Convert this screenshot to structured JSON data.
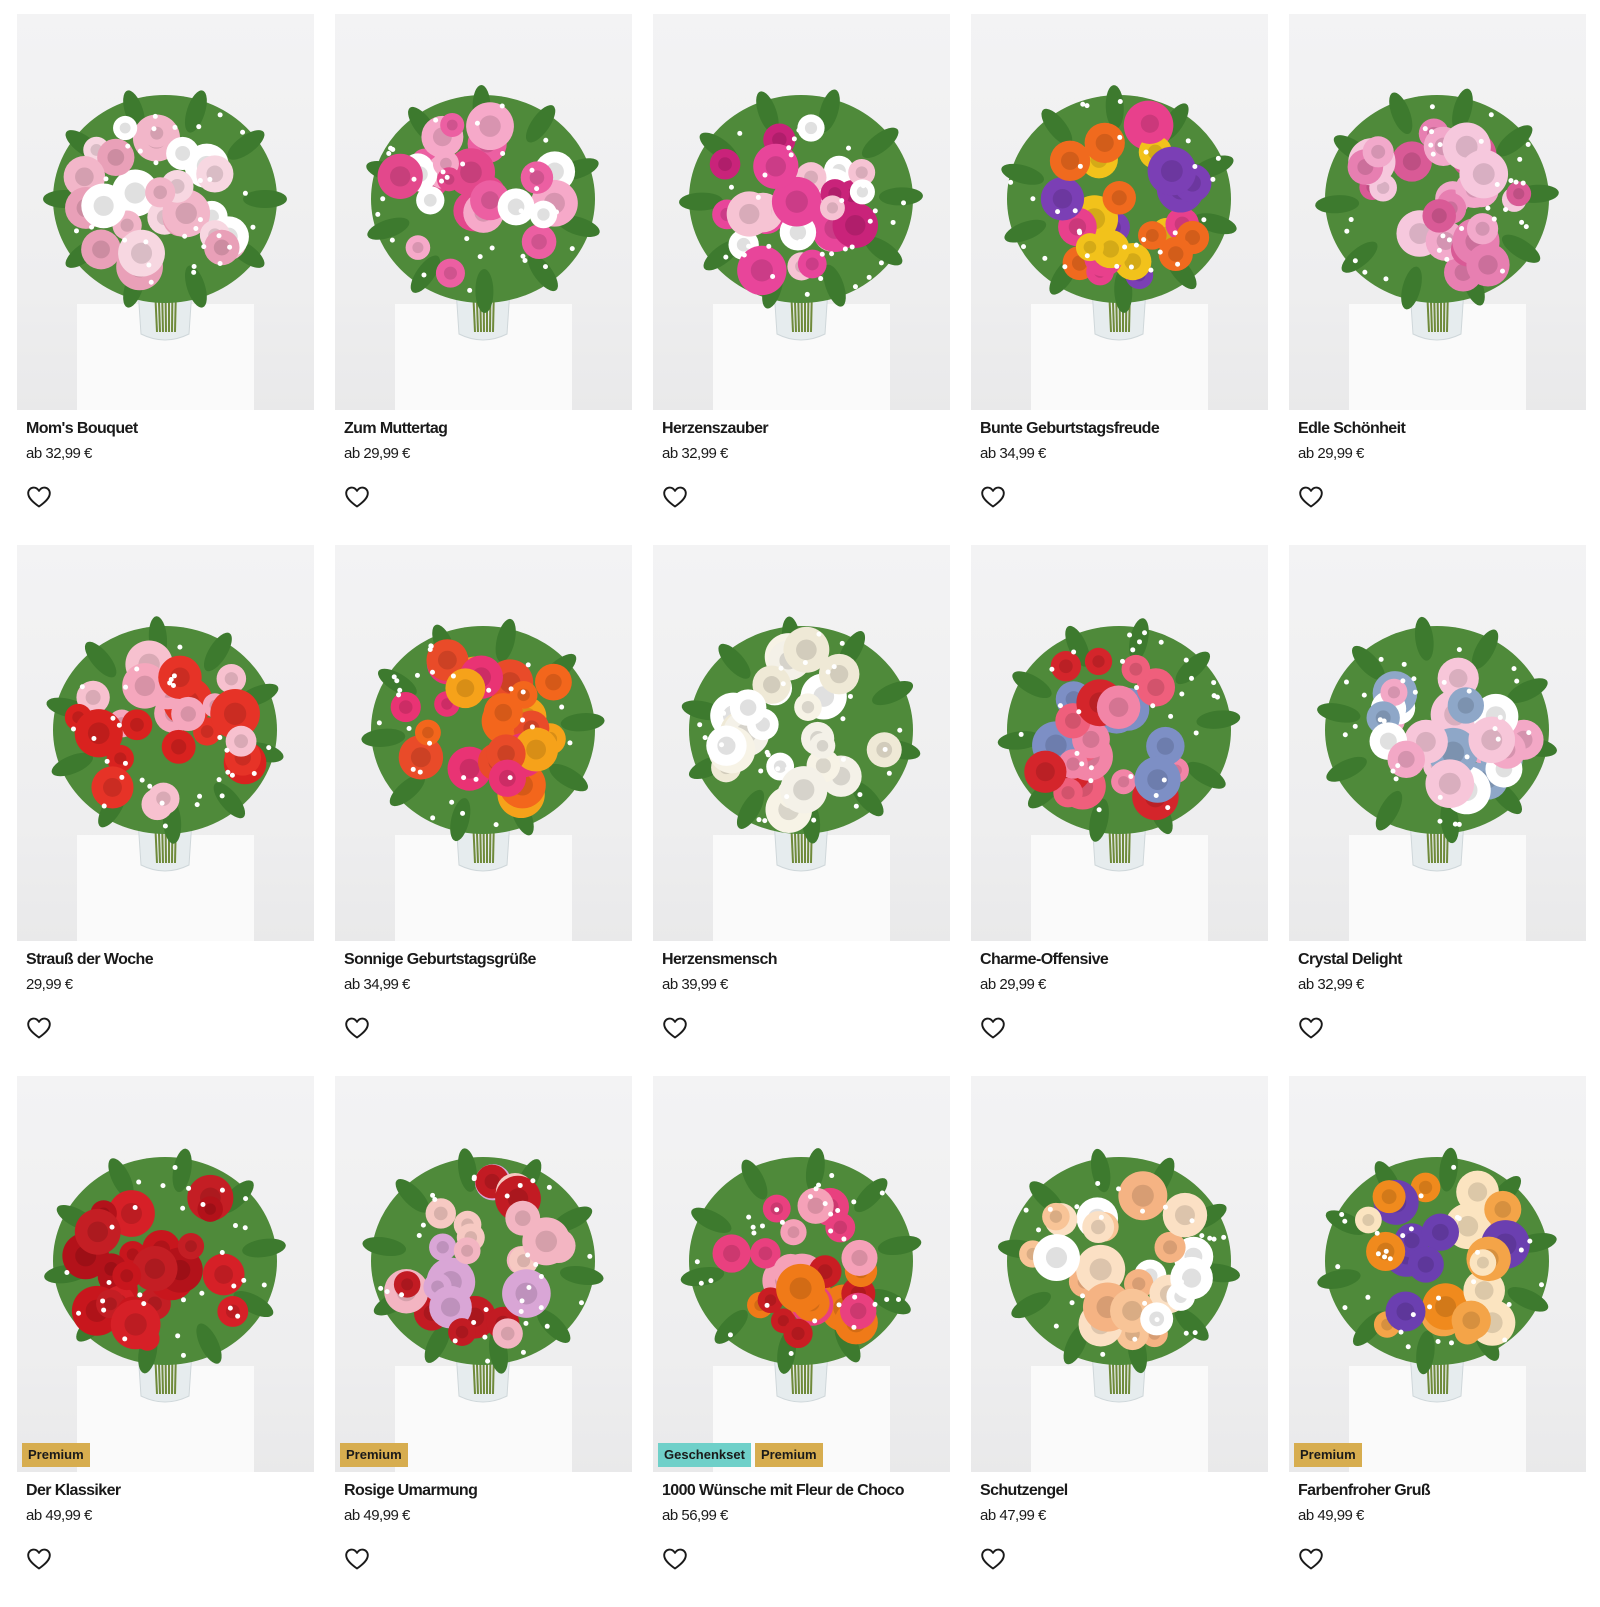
{
  "products": [
    {
      "name": "Mom's Bouquet",
      "price": "ab 32,99 €",
      "badges": [],
      "colors": [
        "#f2b6c9",
        "#ffffff",
        "#f7d7e1",
        "#e9a0b8"
      ]
    },
    {
      "name": "Zum Muttertag",
      "price": "ab 29,99 €",
      "badges": [],
      "colors": [
        "#ec5fa2",
        "#f6a9c9",
        "#ffffff",
        "#e3488c"
      ]
    },
    {
      "name": "Herzenszauber",
      "price": "ab 32,99 €",
      "badges": [],
      "colors": [
        "#e8459a",
        "#f6c3d3",
        "#ffffff",
        "#c9237a"
      ]
    },
    {
      "name": "Bunte Geburtstagsfreude",
      "price": "ab 34,99 €",
      "badges": [],
      "colors": [
        "#f06a1e",
        "#f2c21b",
        "#7b3fb5",
        "#e8408c"
      ]
    },
    {
      "name": "Edle Schönheit",
      "price": "ab 29,99 €",
      "badges": [],
      "colors": [
        "#e77fb1",
        "#f2a9cb",
        "#d95a96",
        "#f6c8dd"
      ]
    },
    {
      "name": "Strauß der Woche",
      "price": "29,99 €",
      "badges": [],
      "colors": [
        "#d9221f",
        "#f5a7bd",
        "#e63327",
        "#f7c1cf"
      ]
    },
    {
      "name": "Sonnige Geburtstagsgrüße",
      "price": "ab 34,99 €",
      "badges": [],
      "colors": [
        "#f3661c",
        "#e93374",
        "#f6a21a",
        "#e94b29"
      ]
    },
    {
      "name": "Herzensmensch",
      "price": "ab 39,99 €",
      "badges": [],
      "colors": [
        "#f7f3e6",
        "#ffffff",
        "#efe9d6",
        "#f4f1e8"
      ]
    },
    {
      "name": "Charme-Offensive",
      "price": "ab 29,99 €",
      "badges": [],
      "colors": [
        "#d4252b",
        "#f285a7",
        "#7d8fc5",
        "#ef5f7c"
      ]
    },
    {
      "name": "Crystal Delight",
      "price": "ab 32,99 €",
      "badges": [],
      "colors": [
        "#f3a8c6",
        "#f7c6d9",
        "#8ea7c8",
        "#ffffff"
      ]
    },
    {
      "name": "Der Klassiker",
      "price": "ab 49,99 €",
      "badges": [
        "Premium"
      ],
      "colors": [
        "#c8161d",
        "#d62027",
        "#b3121a",
        "#c41e24"
      ]
    },
    {
      "name": "Rosige Umarmung",
      "price": "ab 49,99 €",
      "badges": [
        "Premium"
      ],
      "colors": [
        "#c21b23",
        "#f3b5c2",
        "#d9a6d6",
        "#f6c9c2"
      ]
    },
    {
      "name": "1000 Wünsche mit Fleur de Choco",
      "price": "ab 56,99 €",
      "badges": [
        "Geschenkset",
        "Premium"
      ],
      "colors": [
        "#f07a18",
        "#e9407f",
        "#c91d23",
        "#f5a1b8"
      ]
    },
    {
      "name": "Schutzengel",
      "price": "ab 47,99 €",
      "badges": [],
      "colors": [
        "#f8c497",
        "#ffffff",
        "#f5b383",
        "#fbe0c4"
      ]
    },
    {
      "name": "Farbenfroher Gruß",
      "price": "ab 49,99 €",
      "badges": [
        "Premium"
      ],
      "colors": [
        "#f4a448",
        "#6b3fb0",
        "#f08a1d",
        "#fbe4c0"
      ]
    }
  ],
  "ui": {
    "accent_premium": "#d7ad4f",
    "accent_gift": "#6fd0c9",
    "favorite_icon": "heart-outline-icon"
  }
}
